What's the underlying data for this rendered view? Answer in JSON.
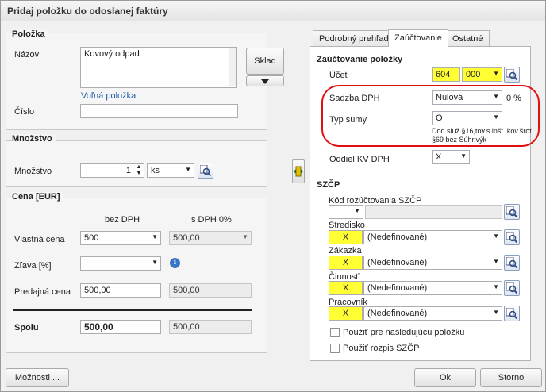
{
  "window": {
    "title": "Pridaj položku do odoslanej faktúry"
  },
  "polozka": {
    "header": "Položka",
    "nazov_label": "Názov",
    "nazov_value": "Kovový odpad",
    "volna_link": "Voľná položka",
    "cislo_label": "Číslo",
    "cislo_value": "",
    "sklad_button": "Sklad"
  },
  "mnozstvo": {
    "header": "Množstvo",
    "label": "Množstvo",
    "value": "1",
    "unit": "ks"
  },
  "cena": {
    "header": "Cena [EUR]",
    "col_bez": "bez DPH",
    "col_s": "s DPH 0%",
    "vlastna_label": "Vlastná cena",
    "vlastna_bez": "500",
    "vlastna_s": "500,00",
    "zlava_label": "Zľava [%]",
    "zlava_value": "",
    "predajna_label": "Predajná cena",
    "predajna_bez": "500,00",
    "predajna_s": "500,00",
    "spolu_label": "Spolu",
    "spolu_bez": "500,00",
    "spolu_s": "500,00"
  },
  "tabs": [
    {
      "label": "Podrobný prehľad"
    },
    {
      "label": "Zaúčtovanie"
    },
    {
      "label": "Ostatné"
    }
  ],
  "zauctovanie": {
    "header": "Zaúčtovanie položky",
    "ucet_label": "Účet",
    "ucet_syn": "604",
    "ucet_an": "000",
    "sadzba_label": "Sadzba DPH",
    "sadzba_value": "Nulová",
    "sadzba_pct": "0 %",
    "typ_label": "Typ sumy",
    "typ_value": "O",
    "typ_desc_1": "Dod.služ.§16,tov.s inšt.,kov.šrot",
    "typ_desc_2": "§69 bez Súhr.výk",
    "oddiel_label": "Oddiel KV DPH",
    "oddiel_value": "X"
  },
  "szcp": {
    "header": "SZČP",
    "kod_label": "Kód rozúčtovania SZČP",
    "kod_value": "",
    "stredisko_label": "Stredisko",
    "stredisko_code": "X",
    "stredisko_value": "(Nedefinované)",
    "zakazka_label": "Zákazka",
    "zakazka_code": "X",
    "zakazka_value": "(Nedefinované)",
    "cinnost_label": "Činnosť",
    "cinnost_code": "X",
    "cinnost_value": "(Nedefinované)",
    "pracovnik_label": "Pracovník",
    "pracovnik_code": "X",
    "pracovnik_value": "(Nedefinované)",
    "chk_next_label": "Použiť pre nasledujúcu položku",
    "chk_rozpis_label": "Použiť rozpis SZČP"
  },
  "footer": {
    "moznosti": "Možnosti ...",
    "ok": "Ok",
    "storno": "Storno"
  },
  "colors": {
    "highlight_ring": "#e01010",
    "yellow_field": "#ffff33",
    "link": "#1a5aa6"
  }
}
